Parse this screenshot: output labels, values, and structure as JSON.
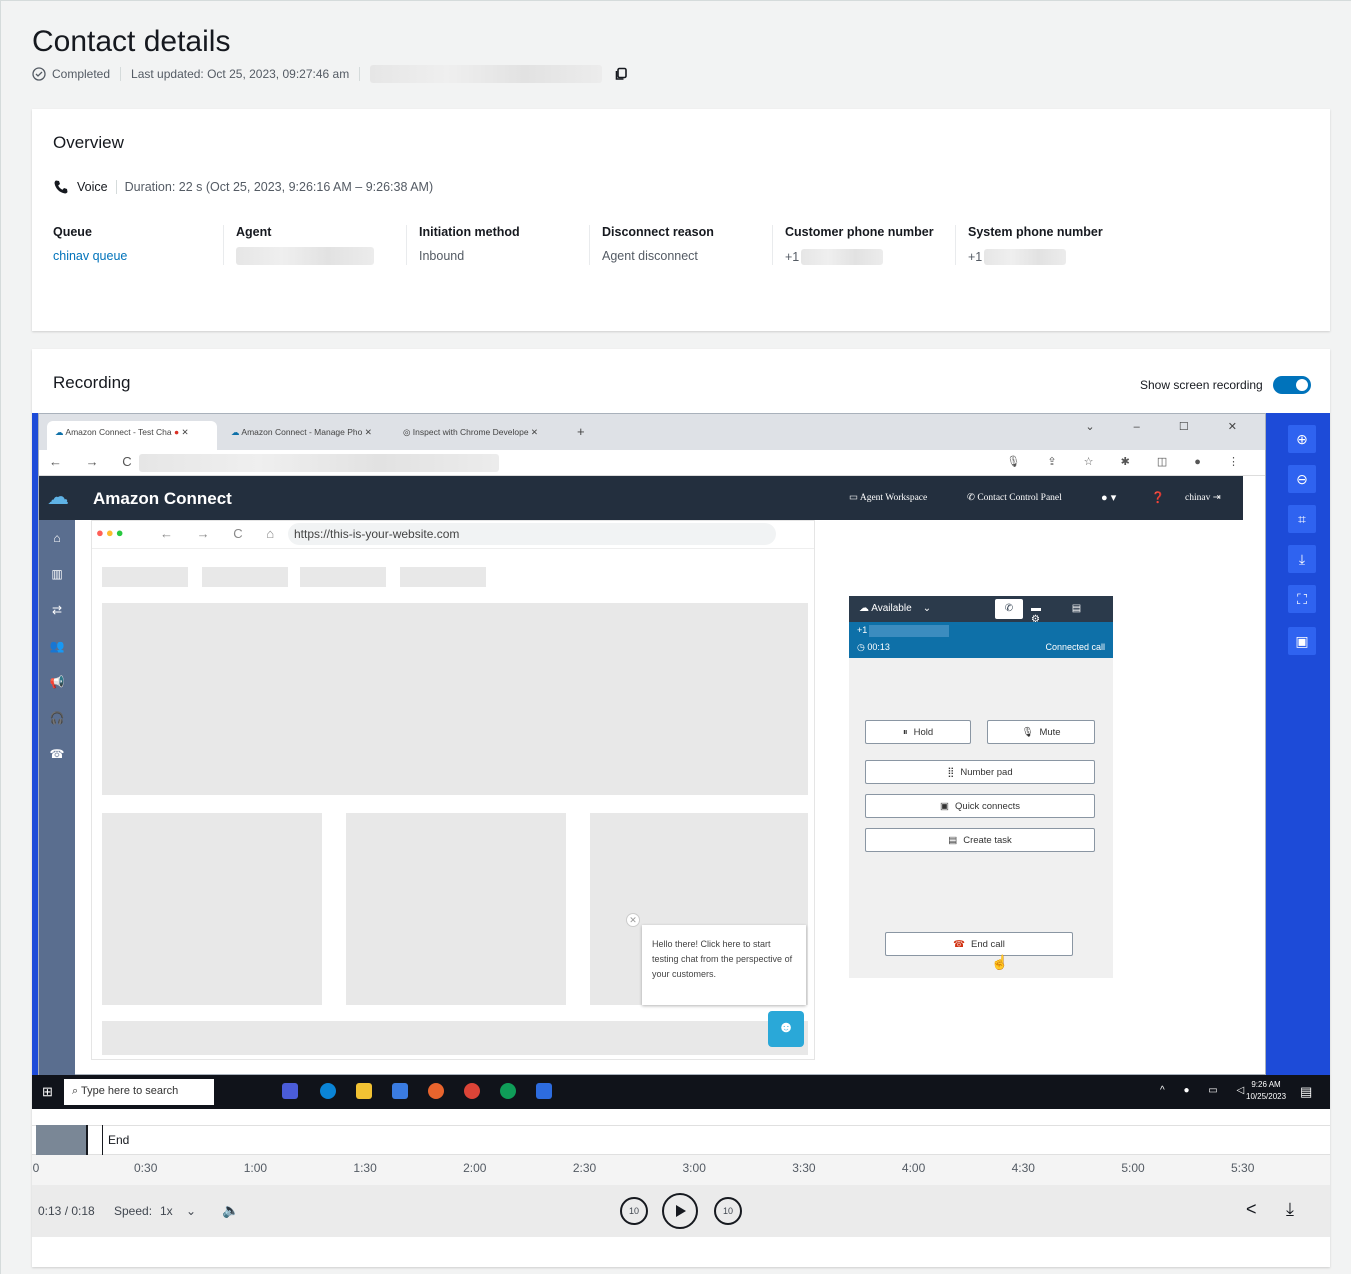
{
  "header": {
    "title": "Contact details",
    "status": "Completed",
    "last_updated": "Last updated: Oct 25, 2023, 09:27:46 am"
  },
  "overview": {
    "heading": "Overview",
    "channel": "Voice",
    "duration": "Duration: 22 s (Oct 25, 2023, 9:26:16 AM – 9:26:38 AM)",
    "columns": [
      {
        "label": "Queue",
        "value": "chinav queue"
      },
      {
        "label": "Agent",
        "value": ""
      },
      {
        "label": "Initiation method",
        "value": "Inbound"
      },
      {
        "label": "Disconnect reason",
        "value": "Agent disconnect"
      },
      {
        "label": "Customer phone number",
        "value": "+1"
      },
      {
        "label": "System phone number",
        "value": "+1"
      }
    ]
  },
  "recording": {
    "heading": "Recording",
    "toggle_label": "Show screen recording",
    "toggle_on": true
  },
  "screen": {
    "tabs": [
      "Amazon Connect - Test Cha",
      "Amazon Connect - Manage Pho",
      "Inspect with Chrome Develope"
    ],
    "new_tab": "+",
    "app_title": "Amazon Connect",
    "nav_agent_workspace": "Agent Workspace",
    "nav_ccp": "Contact Control Panel",
    "user": "chinav",
    "site_url": "https://this-is-your-website.com",
    "ccp": {
      "status": "Available",
      "phone": "+1",
      "timer": "00:13",
      "call_state": "Connected call",
      "hold": "Hold",
      "mute": "Mute",
      "number_pad": "Number pad",
      "quick_connects": "Quick connects",
      "create_task": "Create task",
      "end_call": "End call"
    },
    "chat_bubble": "Hello there! Click here to start testing chat from the perspective of your customers.",
    "taskbar_search": "Type here to search",
    "clock_time": "9:26 AM",
    "clock_date": "10/25/2023"
  },
  "timeline": {
    "marker_label": "End",
    "ticks": [
      "0",
      "0:30",
      "1:00",
      "1:30",
      "2:00",
      "2:30",
      "3:00",
      "3:30",
      "4:00",
      "4:30",
      "5:00",
      "5:30"
    ]
  },
  "controls": {
    "time": "0:13 / 0:18",
    "speed_label": "Speed:",
    "speed_value": "1x",
    "rewind_label": "10",
    "forward_label": "10"
  }
}
